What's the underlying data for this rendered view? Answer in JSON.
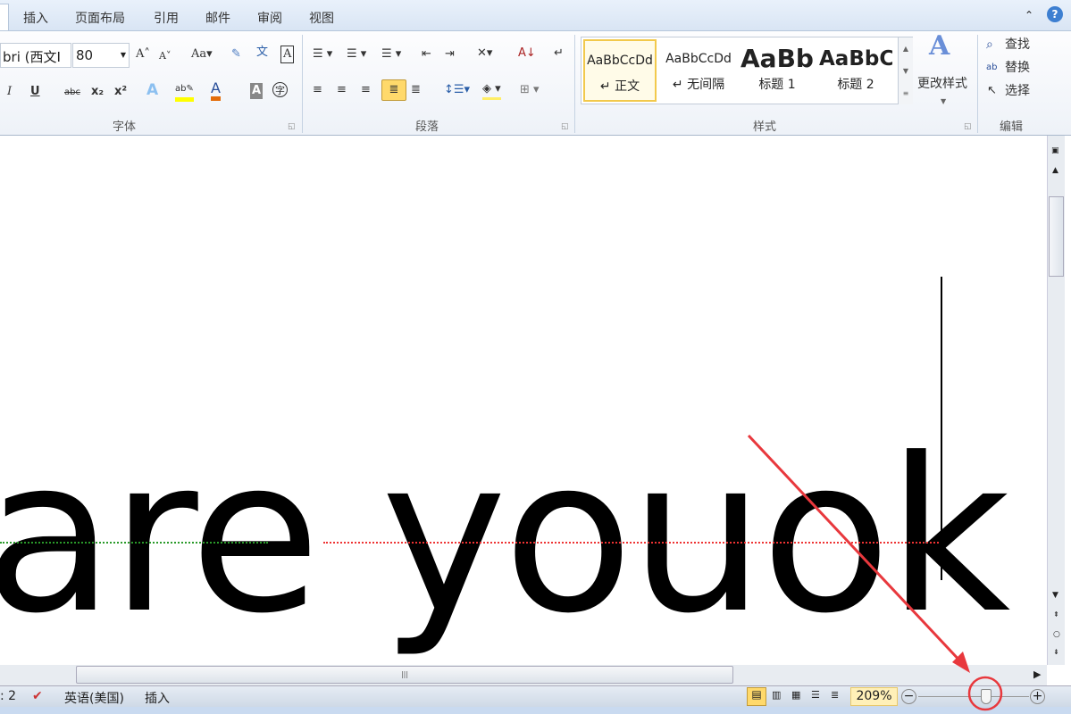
{
  "tabs": [
    "插入",
    "页面布局",
    "引用",
    "邮件",
    "审阅",
    "视图"
  ],
  "font": {
    "name": "bri (西文Ⅰ",
    "size": "80",
    "group_label": "字体"
  },
  "paragraph": {
    "group_label": "段落"
  },
  "styles": {
    "group_label": "样式",
    "items": [
      {
        "sample": "AaBbCcDd",
        "name": "↵ 正文"
      },
      {
        "sample": "AaBbCcDd",
        "name": "↵ 无间隔"
      },
      {
        "sample": "AaBb",
        "name": "标题 1"
      },
      {
        "sample": "AaBbC",
        "name": "标题 2"
      }
    ],
    "change_styles": "更改样式"
  },
  "editing": {
    "group_label": "编辑",
    "find": "查找",
    "replace": "替换",
    "select": "选择"
  },
  "document": {
    "text": "are youok"
  },
  "status": {
    "page_fragment": ": 2",
    "language": "英语(美国)",
    "mode": "插入",
    "zoom": "209%",
    "zoom_percent": 209
  },
  "colors": {
    "accent": "#ffd96b",
    "annotation": "#e8383d"
  }
}
